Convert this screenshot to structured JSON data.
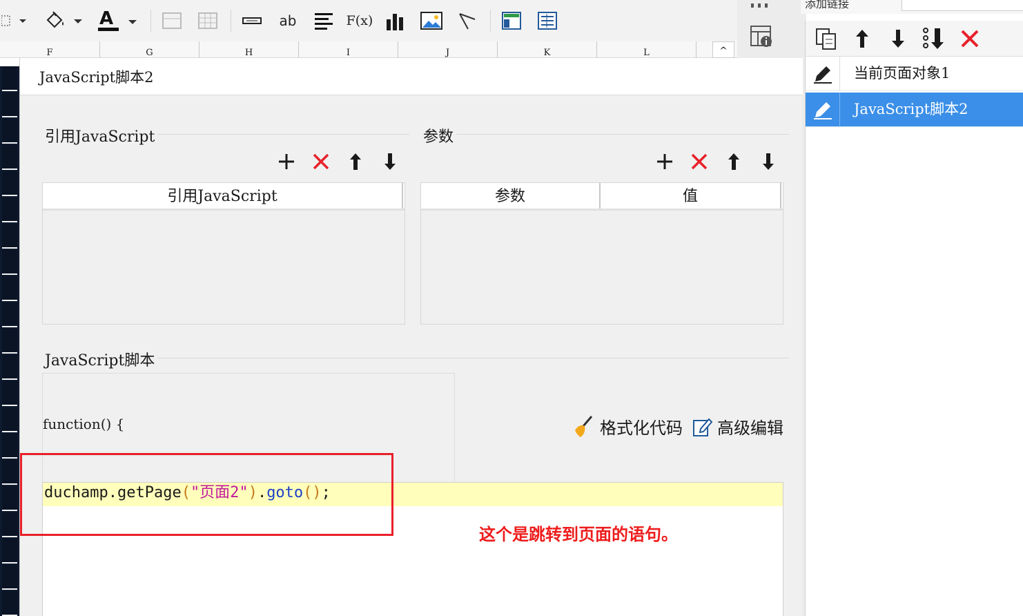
{
  "toolbar": {
    "text_icon_ab": "ab",
    "formula_icon_label": "F(x)",
    "icons": [
      "cell-select-icon",
      "paint-bucket-icon",
      "font-color-icon",
      "border-icon",
      "table-icon",
      "textbox-icon",
      "text-ab-icon",
      "align-icon",
      "formula-icon",
      "bar-chart-icon",
      "image-icon",
      "line-icon",
      "layout-icon",
      "report-icon"
    ]
  },
  "columns": [
    "F",
    "G",
    "H",
    "I",
    "J",
    "K",
    "L"
  ],
  "right_panel": {
    "header_label": "添加链接",
    "tools": [
      "copy-icon",
      "arrow-up-icon",
      "arrow-down-icon",
      "move-bottom-icon",
      "delete-icon"
    ],
    "items": [
      {
        "label": "当前页面对象1",
        "selected": false
      },
      {
        "label": "JavaScript脚本2",
        "selected": true
      }
    ]
  },
  "dialog": {
    "title": "JavaScript脚本2",
    "ref_section": {
      "legend": "引用JavaScript",
      "column": "引用JavaScript"
    },
    "param_section": {
      "legend": "参数",
      "columns": [
        "参数",
        "值"
      ]
    },
    "script_section": {
      "legend": "JavaScript脚本",
      "function_header": "function() {",
      "format_code_label": "格式化代码",
      "advanced_edit_label": "高级编辑",
      "code_tokens": {
        "object": "duchamp",
        "dot1": ".",
        "method1": "getPage",
        "open1": "(",
        "string": "\"页面2\"",
        "close1": ")",
        "dot2": ".",
        "method2": "goto",
        "open2": "(",
        "close2": ")",
        "semicolon": ";"
      }
    }
  },
  "annotation": "这个是跳转到页面的语句。",
  "colors": {
    "accent": "#3b8fe8",
    "delete_red": "#e8202a",
    "highlight": "#fffebb",
    "annotation": "#ee1c1c"
  }
}
